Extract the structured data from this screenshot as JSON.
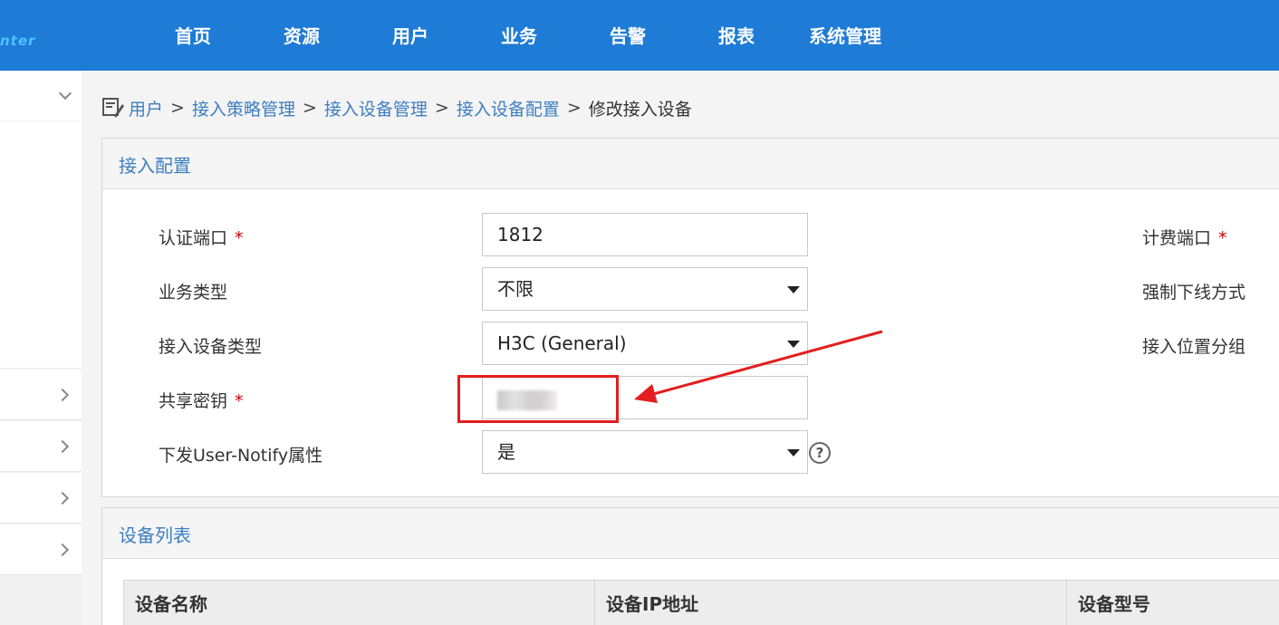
{
  "app": {
    "logo_text": "nter"
  },
  "nav": {
    "items": [
      "首页",
      "资源",
      "用户",
      "业务",
      "告警",
      "报表",
      "系统管理"
    ]
  },
  "breadcrumb": {
    "items": [
      "用户",
      "接入策略管理",
      "接入设备管理",
      "接入设备配置"
    ],
    "separator": ">",
    "current": "修改接入设备"
  },
  "access_config": {
    "title": "接入配置",
    "auth_port": {
      "label": "认证端口",
      "required": "*",
      "value": "1812"
    },
    "service_type": {
      "label": "业务类型",
      "value": "不限"
    },
    "device_type": {
      "label": "接入设备类型",
      "value": "H3C (General)"
    },
    "shared_key": {
      "label": "共享密钥",
      "required": "*"
    },
    "user_notify": {
      "label": "下发User-Notify属性",
      "value": "是"
    },
    "acct_port": {
      "label": "计费端口",
      "required": "*"
    },
    "force_offline": {
      "label": "强制下线方式"
    },
    "location_group": {
      "label": "接入位置分组"
    }
  },
  "device_list": {
    "title": "设备列表",
    "columns": [
      "设备名称",
      "设备IP地址",
      "设备型号"
    ]
  },
  "colors": {
    "topbar": "#1e7bd6",
    "link": "#3d7fc1",
    "annotation": "#e21e1e",
    "required": "#cc0000"
  }
}
